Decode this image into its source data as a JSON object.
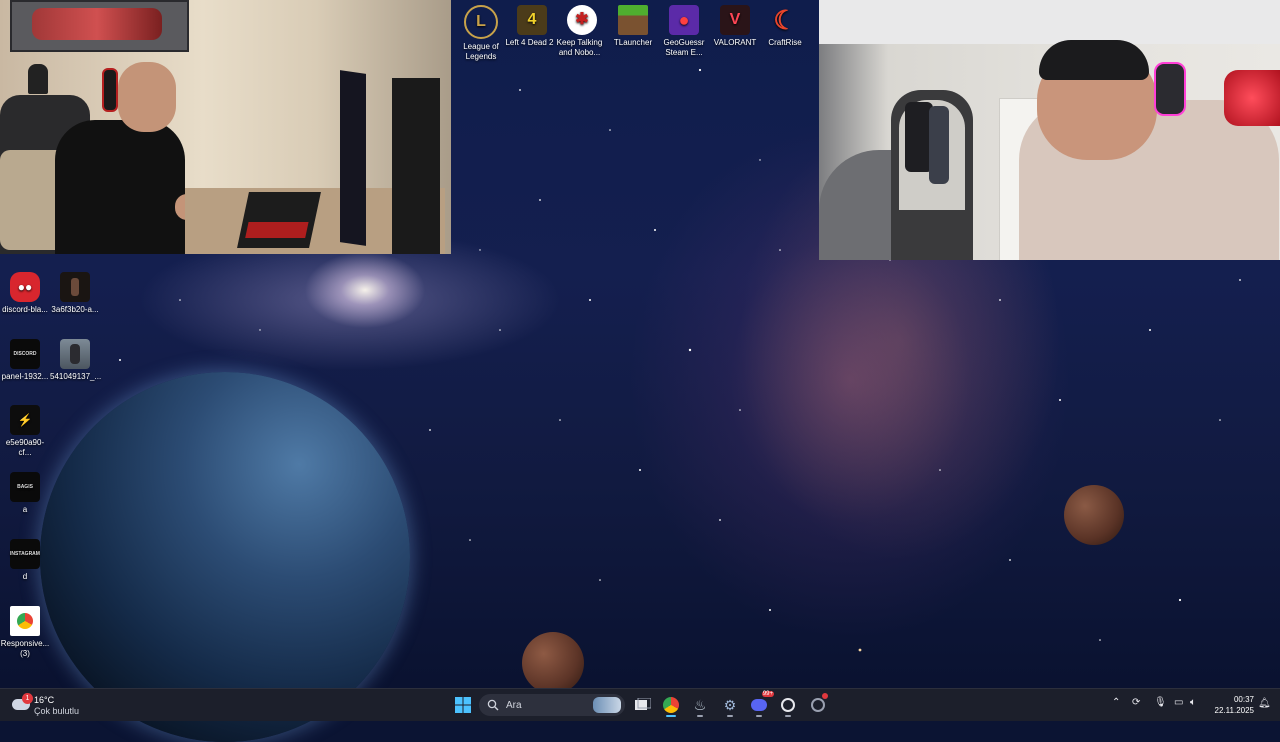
{
  "top_icons": [
    {
      "label": "League of\nLegends",
      "icon": "league-of-legends-icon"
    },
    {
      "label": "Left 4 Dead 2",
      "icon": "left-4-dead-2-icon"
    },
    {
      "label": "Keep Talking\nand Nobo...",
      "icon": "keep-talking-icon"
    },
    {
      "label": "TLauncher",
      "icon": "tlauncher-icon"
    },
    {
      "label": "GeoGuessr\nSteam E...",
      "icon": "geoguessr-icon"
    },
    {
      "label": "VALORANT",
      "icon": "valorant-icon"
    },
    {
      "label": "CraftRise",
      "icon": "craftrise-icon"
    }
  ],
  "left_icons": [
    {
      "label": "discord-bla...",
      "icon": "discord-image-icon"
    },
    {
      "label": "3a6f3b20-a...",
      "icon": "photo-icon"
    },
    {
      "label": "panel-1932...",
      "icon": "panel-image-icon"
    },
    {
      "label": "541049137_...",
      "icon": "photo-icon"
    },
    {
      "label": "e5e90a90-cf...",
      "icon": "image-file-icon"
    },
    {
      "label": "a",
      "icon": "image-file-icon"
    },
    {
      "label": "d",
      "icon": "image-file-icon"
    },
    {
      "label": "Responsive...\n(3)",
      "icon": "chrome-shortcut-icon"
    }
  ],
  "left_icon_captions": {
    "panel": "DISCORD",
    "a": "BAGIS",
    "d": "INSTAGRAM"
  },
  "taskbar": {
    "weather": {
      "temp": "16°C",
      "condition": "Çok bulutlu",
      "badge": "1"
    },
    "search_placeholder": "Ara",
    "discord_badge": "99+",
    "time": "00:37",
    "date": "22.11.2025"
  },
  "colors": {
    "taskbar_bg": "#1c1f2b",
    "accent": "#4cc2ff"
  }
}
